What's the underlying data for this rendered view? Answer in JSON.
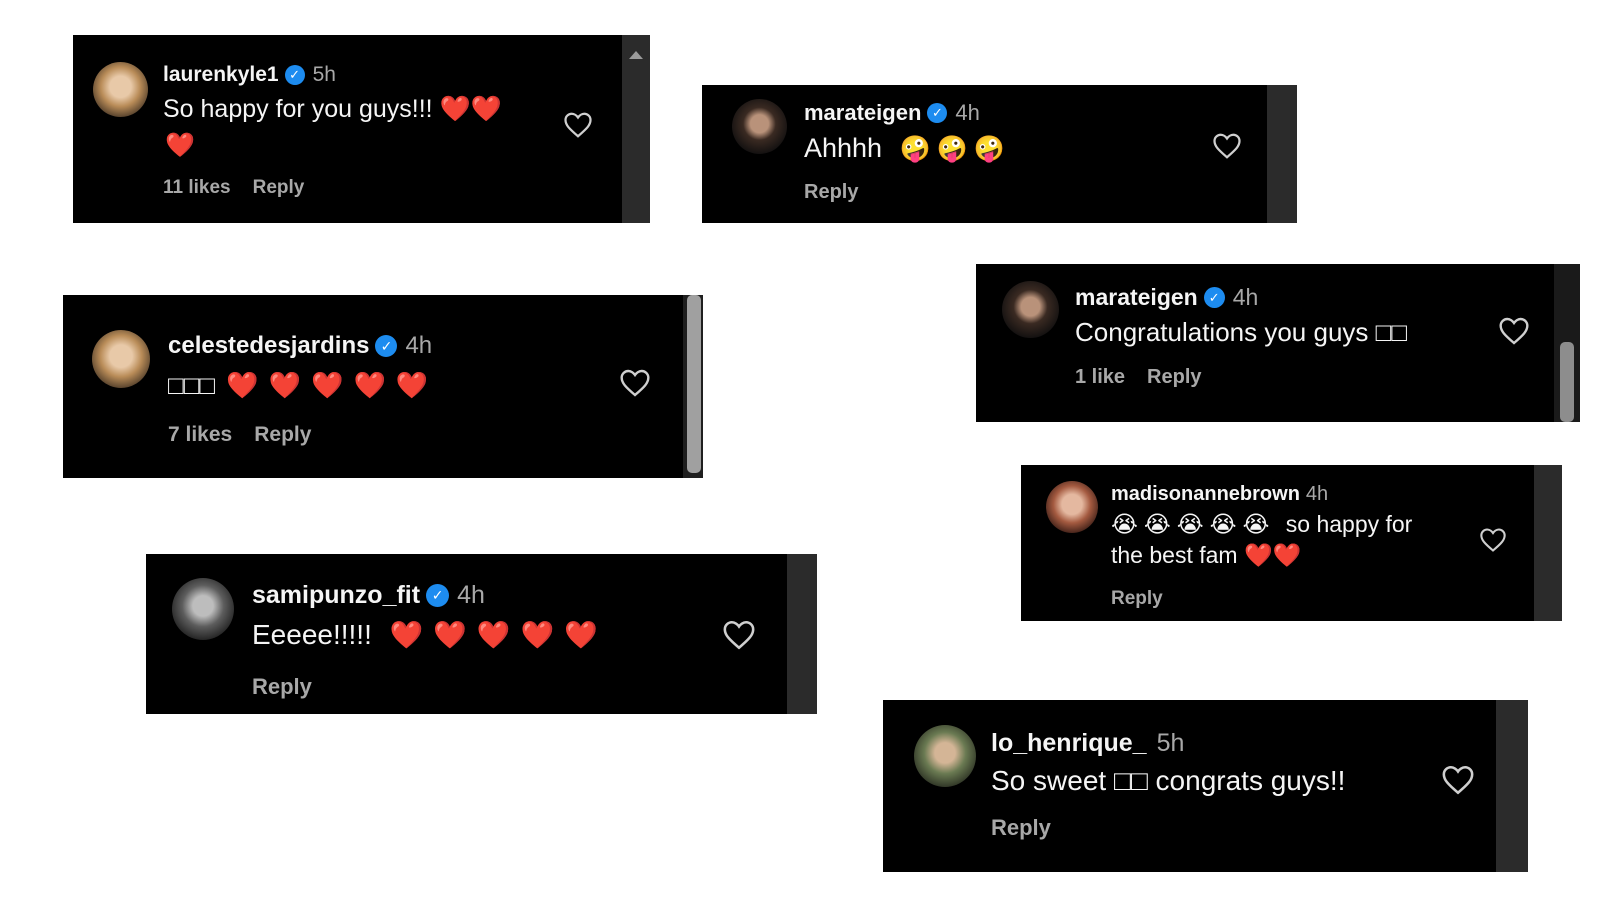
{
  "comments": [
    {
      "username": "laurenkyle1",
      "verified": true,
      "time": "5h",
      "text": "So happy for you guys!!! ❤️❤️",
      "text2": "❤️",
      "likes": "11 likes",
      "reply": "Reply",
      "heart_color": "#ffffff"
    },
    {
      "username": "marateigen",
      "verified": true,
      "time": "4h",
      "text": "Ahhhh",
      "emojis": "🤪🤪🤪",
      "likes": "",
      "reply": "Reply"
    },
    {
      "username": "celestedesjardins",
      "verified": true,
      "time": "4h",
      "text": "□□□",
      "emojis": "❤️❤️❤️❤️❤️",
      "likes": "7 likes",
      "reply": "Reply"
    },
    {
      "username": "marateigen",
      "verified": true,
      "time": "4h",
      "text": "Congratulations you guys □□",
      "likes": "1 like",
      "reply": "Reply"
    },
    {
      "username": "samipunzo_fit",
      "verified": true,
      "time": "4h",
      "text": "Eeeee!!!!!",
      "emojis": "❤️❤️❤️❤️❤️",
      "likes": "",
      "reply": "Reply"
    },
    {
      "username": "madisonannebrown",
      "verified": false,
      "time": "4h",
      "emojis": "😭😭😭😭😭",
      "text": "so happy for",
      "text2": "the best fam ❤️❤️",
      "likes": "",
      "reply": "Reply"
    },
    {
      "username": "lo_henrique_",
      "verified": false,
      "time": "5h",
      "text": "So sweet □□ congrats guys!!",
      "likes": "",
      "reply": "Reply"
    }
  ],
  "icons": {
    "verified": "verified-badge-icon",
    "like": "heart-outline-icon"
  },
  "colors": {
    "card_bg": "#000000",
    "text": "#f5f5f5",
    "muted": "#a8a8a8",
    "verified": "#1d8cf0",
    "emoji_heart": "#e8202a"
  }
}
